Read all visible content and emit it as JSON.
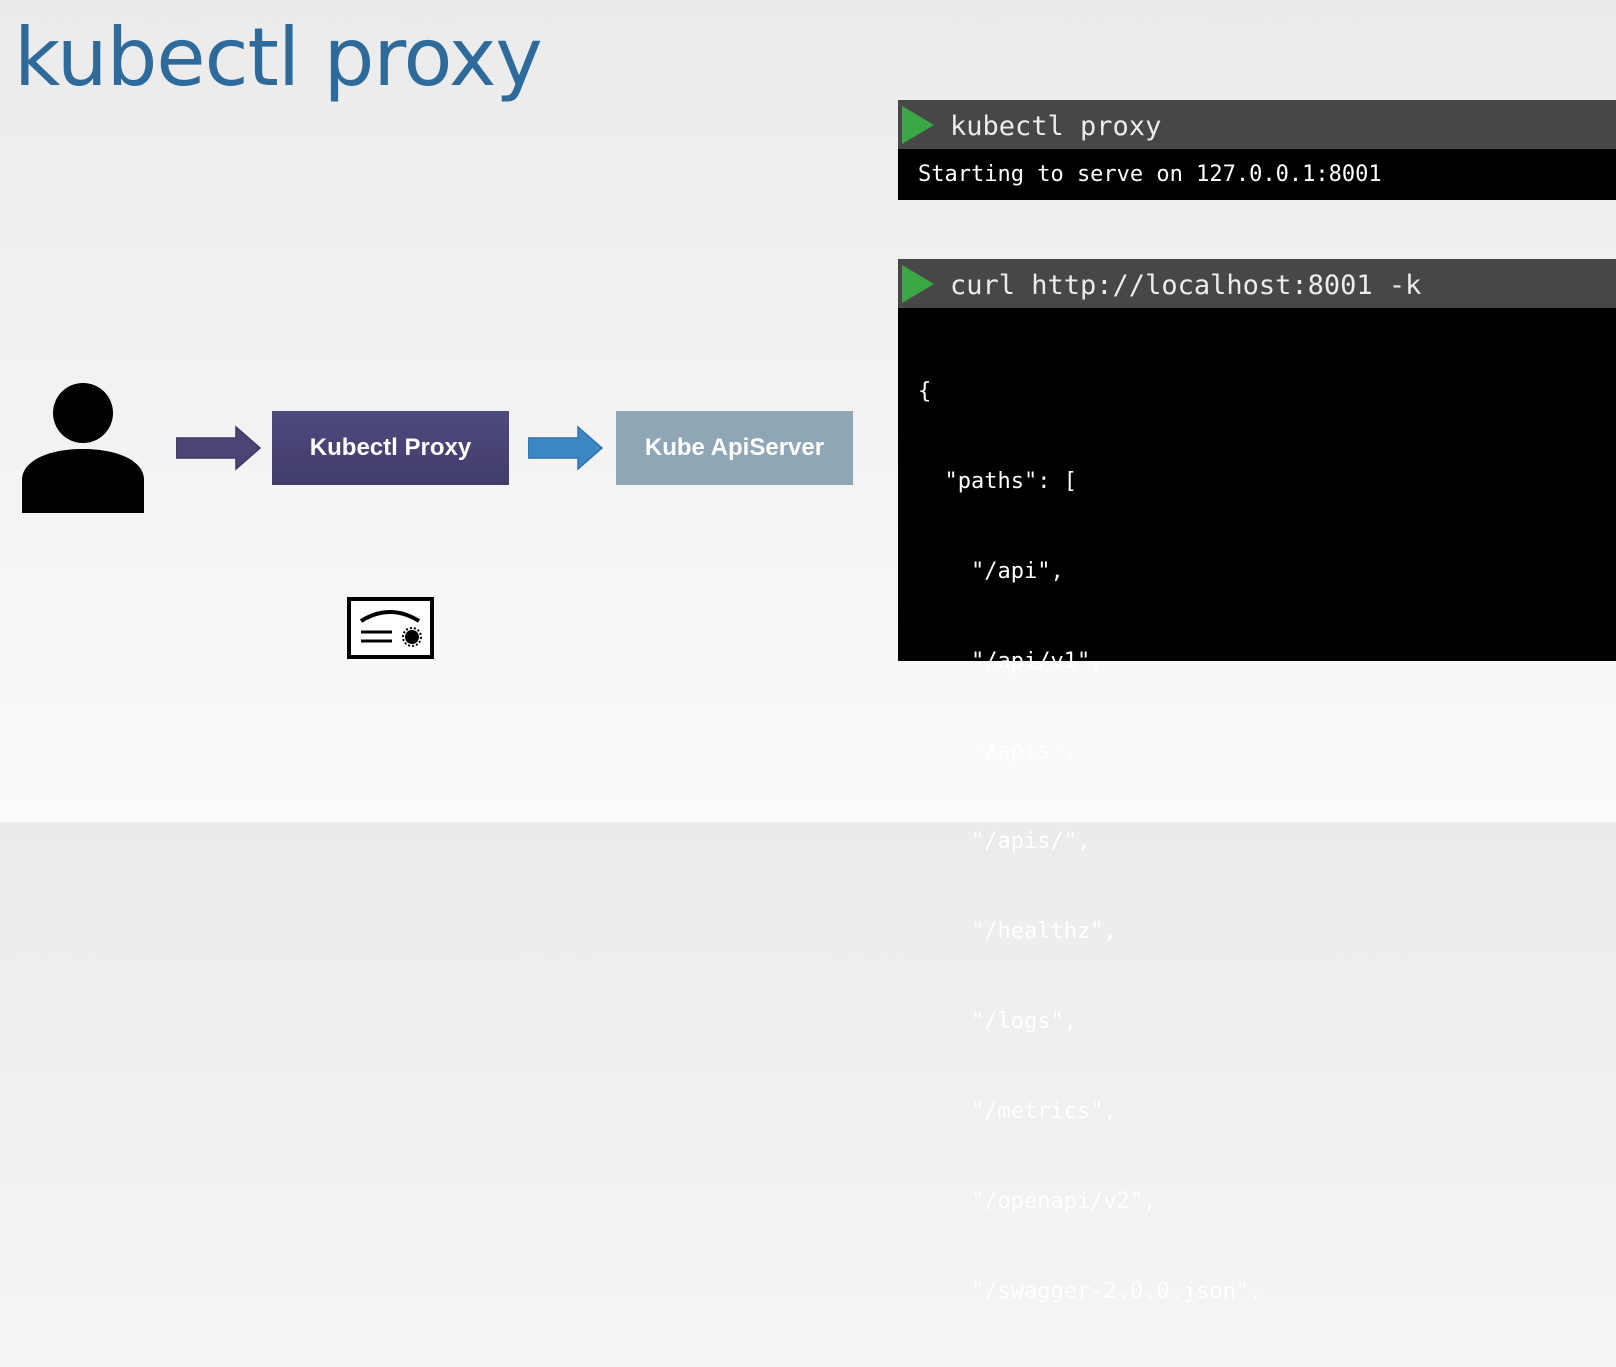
{
  "slide": {
    "title": "kubectl proxy"
  },
  "terminal_1": {
    "command": "kubectl proxy",
    "output": "Starting to serve on 127.0.0.1:8001"
  },
  "terminal_2": {
    "command": "curl http://localhost:8001 -k",
    "output_lines": [
      "{",
      "  \"paths\": [",
      "    \"/api\",",
      "    \"/api/v1\",",
      "    \"/apis\",",
      "    \"/apis/\",",
      "    \"/healthz\",",
      "    \"/logs\",",
      "    \"/metrics\",",
      "    \"/openapi/v2\",",
      "    \"/swagger-2.0.0.json\","
    ]
  },
  "diagram": {
    "user_icon": "user-icon",
    "proxy_label": "Kubectl Proxy",
    "apiserver_label": "Kube ApiServer",
    "certificate_icon": "certificate-icon"
  },
  "colors": {
    "title": "#2f6b9a",
    "proxy_box": "#4a4575",
    "apiserver_box": "#8fa6b6",
    "arrow_user_proxy": "#4a4575",
    "arrow_proxy_api": "#3b88c4",
    "prompt_icon": "#3aa845",
    "terminal_bar": "#474747",
    "terminal_body": "#000000"
  }
}
